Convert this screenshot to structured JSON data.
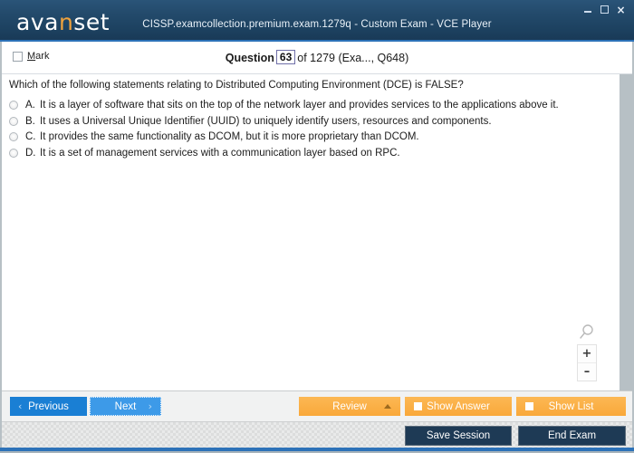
{
  "window": {
    "title": "CISSP.examcollection.premium.exam.1279q - Custom Exam - VCE Player",
    "logo_main_a": "ava",
    "logo_accent": "n",
    "logo_main_b": "set",
    "minimize": "–",
    "maximize": "□",
    "close": "×"
  },
  "infobar": {
    "mark_mnemonic": "M",
    "mark_rest": "ark",
    "question_label": "Question",
    "question_number": "63",
    "question_rest": "of 1279 (Exa..., Q648)"
  },
  "question": {
    "text": "Which of the following statements relating to Distributed Computing Environment (DCE) is FALSE?",
    "options": [
      {
        "letter": "A.",
        "text": "It is a layer of software that sits on the top of the network layer and provides services to the applications above it."
      },
      {
        "letter": "B.",
        "text": "It uses a Universal Unique Identifier (UUID) to uniquely identify users, resources and components."
      },
      {
        "letter": "C.",
        "text": "It provides the same functionality as DCOM, but it is more proprietary than DCOM."
      },
      {
        "letter": "D.",
        "text": "It is a set of management services with a communication layer based on RPC."
      }
    ]
  },
  "zoom_widget": {
    "zoom_in": "+",
    "zoom_out": "–"
  },
  "toolbar": {
    "previous": "Previous",
    "previous_chevron": "‹",
    "next": "Next",
    "next_chevron": "›",
    "review": "Review",
    "show_answer": "Show Answer",
    "show_list": "Show List"
  },
  "statusbar": {
    "save_session": "Save Session",
    "end_exam": "End Exam"
  },
  "colors": {
    "title_bar": "#1d4261",
    "accent_blue": "#2d72b8",
    "orange": "#fbb040",
    "dark_button": "#1e3a55",
    "logo_accent": "#f0a23c"
  }
}
